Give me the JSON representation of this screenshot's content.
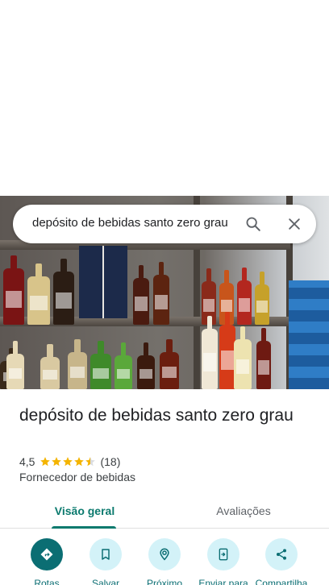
{
  "search": {
    "value": "depósito de bebidas santo zero grau",
    "icon": "search-icon",
    "close_icon": "close-icon"
  },
  "place": {
    "name": "depósito de bebidas santo zero grau",
    "rating": "4,5",
    "rating_value": 4.5,
    "review_count": "(18)",
    "category": "Fornecedor de bebidas"
  },
  "tabs": [
    {
      "label": "Visão geral",
      "active": true
    },
    {
      "label": "Avaliações",
      "active": false
    }
  ],
  "actions": [
    {
      "label": "Rotas",
      "icon": "directions-icon"
    },
    {
      "label": "Salvar",
      "icon": "bookmark-icon"
    },
    {
      "label": "Próximo",
      "icon": "nearby-icon"
    },
    {
      "label": "Enviar para",
      "icon": "send-to-phone-icon"
    },
    {
      "label": "Compartilha",
      "icon": "share-icon"
    }
  ],
  "colors": {
    "accent": "#0b7a6e",
    "action_bg": "#d3f2f8",
    "star": "#f4b400"
  }
}
